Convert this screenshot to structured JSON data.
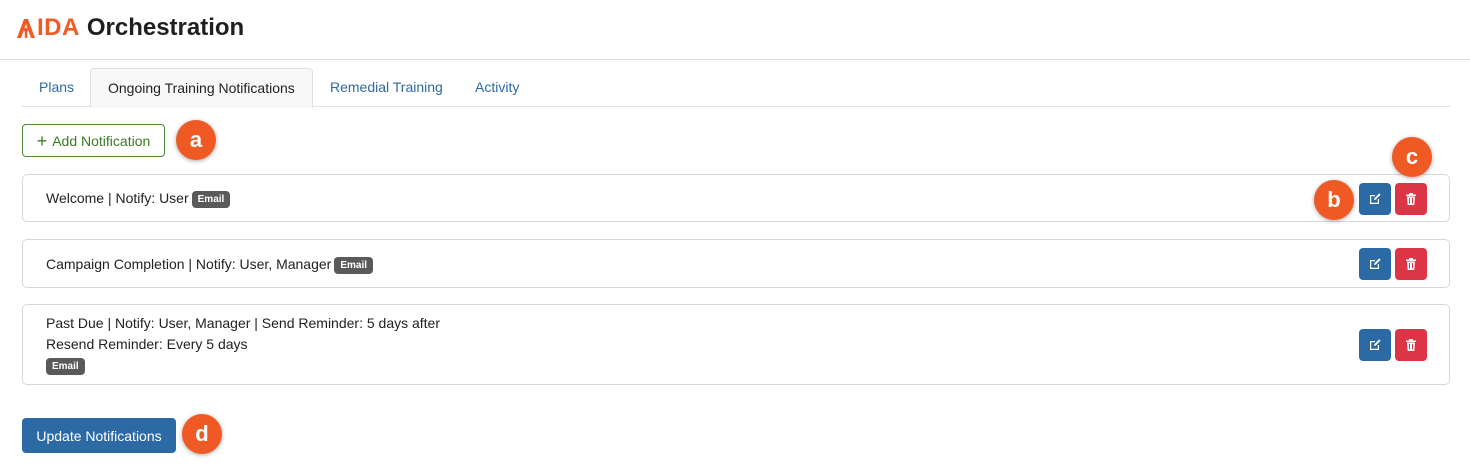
{
  "app": {
    "logo_brand": "IDA",
    "logo_title": "Orchestration",
    "brand_color": "#f15a24"
  },
  "tabs": [
    {
      "label": "Plans",
      "active": false
    },
    {
      "label": "Ongoing Training Notifications",
      "active": true
    },
    {
      "label": "Remedial Training",
      "active": false
    },
    {
      "label": "Activity",
      "active": false
    }
  ],
  "toolbar": {
    "add_label": "Add Notification",
    "add_icon": "plus-icon"
  },
  "notifications": [
    {
      "line1": "Welcome | Notify: User",
      "line2": "",
      "badge": "Email"
    },
    {
      "line1": "Campaign Completion | Notify: User, Manager",
      "line2": "",
      "badge": "Email"
    },
    {
      "line1": "Past Due | Notify: User, Manager | Send Reminder: 5 days after",
      "line2": "Resend Reminder: Every 5 days",
      "badge": "Email"
    }
  ],
  "row_actions": {
    "edit_icon": "edit-icon",
    "delete_icon": "trash-icon"
  },
  "footer": {
    "update_label": "Update Notifications"
  },
  "markers": {
    "a": "a",
    "b": "b",
    "c": "c",
    "d": "d",
    "color": "#ef5a24"
  }
}
